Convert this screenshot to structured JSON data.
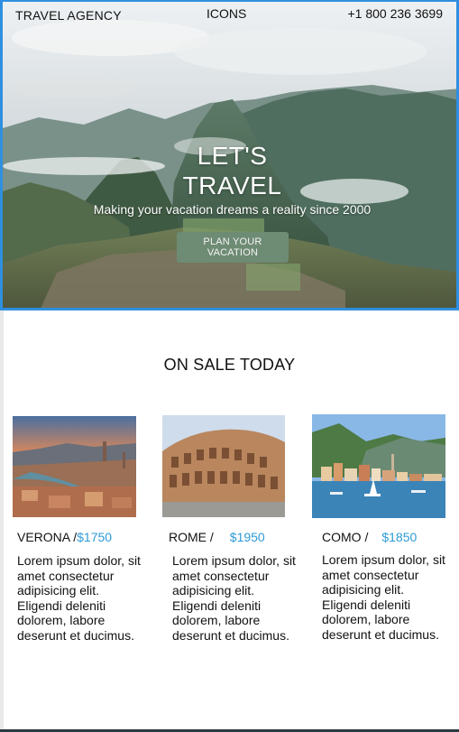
{
  "nav": {
    "brand": "TRAVEL AGENCY",
    "icons": "ICONS",
    "phone": "+1 800 236 3699"
  },
  "hero": {
    "title_line1": "LET'S",
    "title_line2": "TRAVEL",
    "subtitle": "Making your vacation dreams a reality since 2000",
    "cta_label": "PLAN YOUR VACATION"
  },
  "sale": {
    "title": "ON SALE TODAY",
    "cards": [
      {
        "name": "VERONA /",
        "price": "$1750",
        "description": "Lorem ipsum dolor, sit amet consectetur adipisicing elit. Eligendi deleniti dolorem, labore deserunt et ducimus."
      },
      {
        "name": "ROME /",
        "price": "$1950",
        "description": "Lorem ipsum dolor, sit amet consectetur adipisicing elit. Eligendi deleniti dolorem, labore deserunt et ducimus."
      },
      {
        "name": "COMO /",
        "price": "$1850",
        "description": "Lorem ipsum dolor, sit amet consectetur adipisicing elit. Eligendi deleniti dolorem, labore deserunt et ducimus."
      }
    ]
  },
  "colors": {
    "hero_border": "#2f8fe0",
    "cta_bg": "#6e8b74",
    "price": "#2e9bd6"
  }
}
